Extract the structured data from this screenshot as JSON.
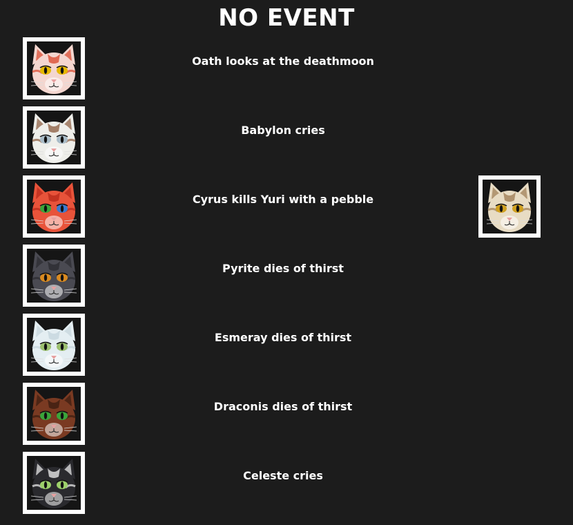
{
  "header": {
    "title": "NO EVENT"
  },
  "events": [
    {
      "text": "Oath looks at the deathmoon",
      "actor": {
        "name": "Oath",
        "icon": "cat-portrait-icon",
        "fur": "#f4d6cf",
        "accent": "#d9442a",
        "eye_left": "#e6b800",
        "eye_right": "#e6b800"
      }
    },
    {
      "text": "Babylon cries",
      "actor": {
        "name": "Babylon",
        "icon": "cat-portrait-icon",
        "fur": "#eeeeea",
        "accent": "#8a5a3c",
        "eye_left": "#a9bcc8",
        "eye_right": "#a9bcc8"
      }
    },
    {
      "text": "Cyrus kills Yuri with a pebble",
      "actor": {
        "name": "Cyrus",
        "icon": "cat-portrait-icon",
        "fur": "#e8533a",
        "accent": "#b8281a",
        "eye_left": "#3aa43a",
        "eye_right": "#3a7ad0"
      },
      "target": {
        "name": "Yuri",
        "icon": "cat-portrait-icon",
        "fur": "#e8dcc4",
        "accent": "#9c7a52",
        "eye_left": "#d0a020",
        "eye_right": "#d0a020"
      }
    },
    {
      "text": "Pyrite dies of thirst",
      "actor": {
        "name": "Pyrite",
        "icon": "cat-portrait-icon",
        "fur": "#4a4a52",
        "accent": "#2b2b30",
        "eye_left": "#d98a20",
        "eye_right": "#d98a20"
      }
    },
    {
      "text": "Esmeray dies of thirst",
      "actor": {
        "name": "Esmeray",
        "icon": "cat-portrait-icon",
        "fur": "#e4eef2",
        "accent": "#c4d4dc",
        "eye_left": "#9cc070",
        "eye_right": "#9cc070"
      }
    },
    {
      "text": "Draconis dies of thirst",
      "actor": {
        "name": "Draconis",
        "icon": "cat-portrait-icon",
        "fur": "#7a3a22",
        "accent": "#3a1c10",
        "eye_left": "#3aa43a",
        "eye_right": "#3aa43a"
      }
    },
    {
      "text": "Celeste cries",
      "actor": {
        "name": "Celeste",
        "icon": "cat-portrait-icon",
        "fur": "#2a2a2e",
        "accent": "#f2f2f2",
        "eye_left": "#9cd06a",
        "eye_right": "#9cd06a"
      }
    }
  ]
}
